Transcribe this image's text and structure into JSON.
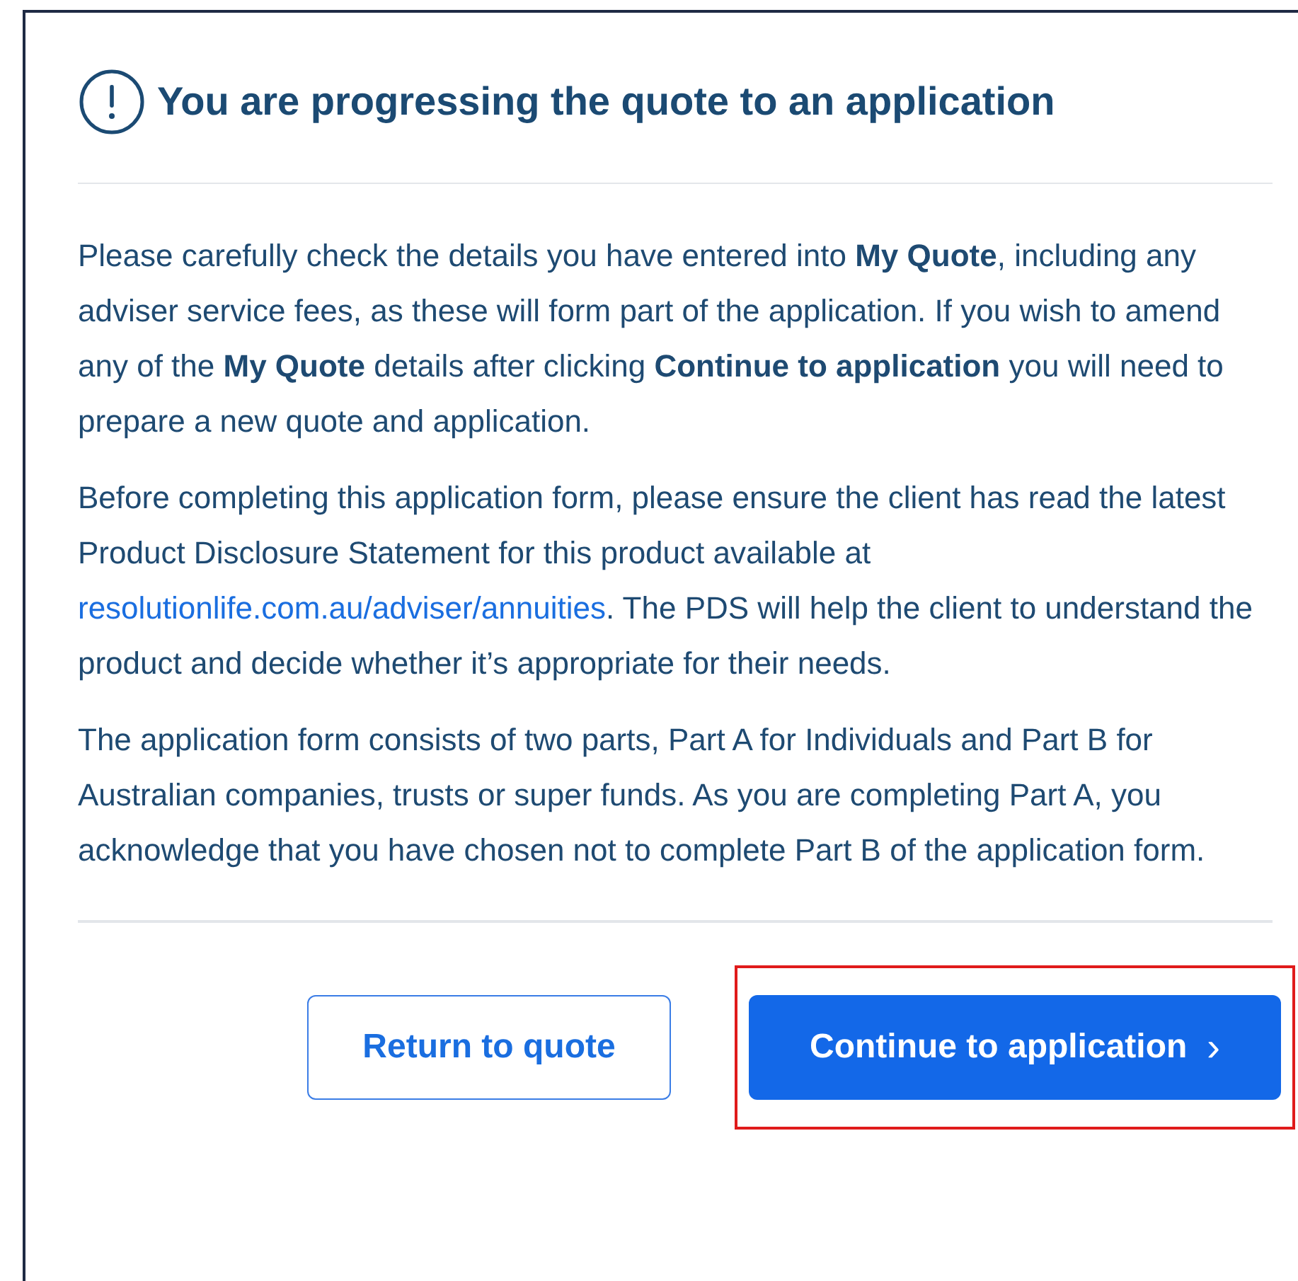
{
  "dialog": {
    "title": "You are progressing the quote to an application",
    "paragraphs": [
      {
        "segments": [
          {
            "kind": "text",
            "text": "Please carefully check the details you have entered into **My Quote**, including any adviser service fees, as these will form part of the application. If you wish to amend any of the **My Quote** details after clicking **Continue to application** you will need to prepare a new quote and application."
          }
        ]
      },
      {
        "segments": [
          {
            "kind": "text",
            "text": "Before completing this application form, please ensure the client has read the latest Product Disclosure Statement for this product available at "
          },
          {
            "kind": "link",
            "text": "resolutionlife.com.au/adviser/annuities"
          },
          {
            "kind": "text",
            "text": ". The PDS will help the client to understand the product and decide whether it’s appropriate for their needs."
          }
        ]
      },
      {
        "segments": [
          {
            "kind": "text",
            "text": "The application form consists of two parts, Part A for Individuals and Part B for Australian companies, trusts or super funds. As you are completing Part A, you acknowledge that you have chosen not to complete Part B of the application form."
          }
        ]
      }
    ],
    "buttons": [
      {
        "kind": "secondary",
        "label": "Return to quote",
        "highlighted": false
      },
      {
        "kind": "primary",
        "label": "Continue to application",
        "chevron": "›",
        "highlighted": true
      }
    ]
  }
}
